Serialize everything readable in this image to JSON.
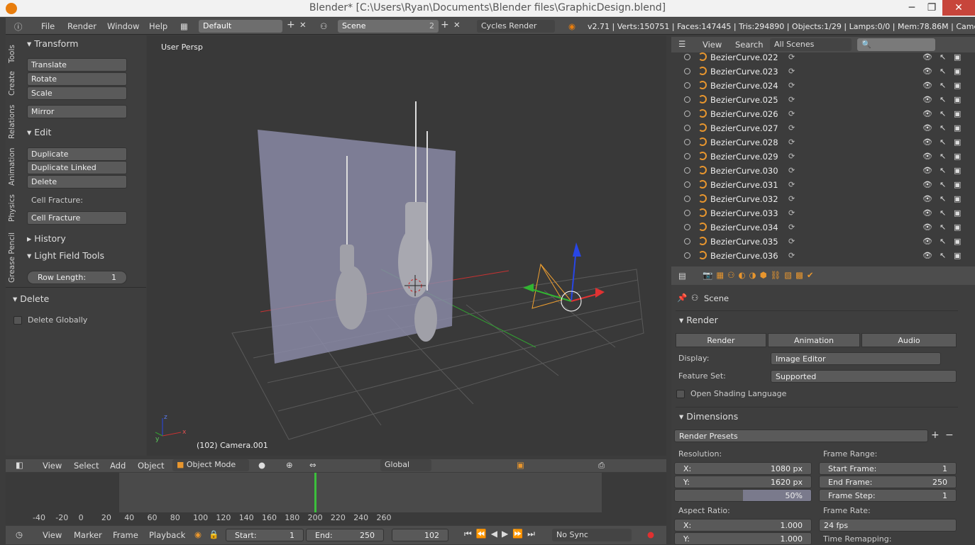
{
  "window": {
    "title": "Blender* [C:\\Users\\Ryan\\Documents\\Blender files\\GraphicDesign.blend]",
    "minimize": "─",
    "maximize": "❐",
    "close": "✕"
  },
  "infobar": {
    "menus": [
      "File",
      "Render",
      "Window",
      "Help"
    ],
    "screen_layout": "Default",
    "scene": "Scene",
    "scene_users": "2",
    "engine": "Cycles Render",
    "stats": "v2.71 | Verts:150751 | Faces:147445 | Tris:294890 | Objects:1/29 | Lamps:0/0 | Mem:78.86M | Camera.001"
  },
  "tool_tabs": [
    "Tools",
    "Create",
    "Relations",
    "Animation",
    "Physics",
    "Grease Pencil"
  ],
  "toolshelf": {
    "transform": {
      "title": "Transform",
      "buttons": [
        "Translate",
        "Rotate",
        "Scale",
        "Mirror"
      ]
    },
    "edit": {
      "title": "Edit",
      "buttons": [
        "Duplicate",
        "Duplicate Linked",
        "Delete"
      ],
      "cell_fracture_label": "Cell Fracture:",
      "cell_fracture_button": "Cell Fracture"
    },
    "history": {
      "title": "History"
    },
    "light_field": {
      "title": "Light Field Tools",
      "row_length_label": "Row Length:",
      "row_length_value": "1"
    }
  },
  "operator_panel": {
    "title": "Delete",
    "checkbox_label": "Delete Globally"
  },
  "viewport": {
    "view_name": "User Persp",
    "object_info": "(102) Camera.001"
  },
  "viewport_header": {
    "menus": [
      "View",
      "Select",
      "Add",
      "Object"
    ],
    "mode": "Object Mode",
    "orientation": "Global"
  },
  "timeline": {
    "ticks": [
      "-40",
      "-20",
      "0",
      "20",
      "40",
      "60",
      "80",
      "100",
      "120",
      "140",
      "160",
      "180",
      "200",
      "220",
      "240",
      "260"
    ],
    "current_frame": 102,
    "footer_menus": [
      "View",
      "Marker",
      "Frame",
      "Playback"
    ],
    "start_label": "Start:",
    "start": "1",
    "end_label": "End:",
    "end": "250",
    "frame": "102",
    "sync": "No Sync"
  },
  "outliner": {
    "menus": [
      "View",
      "Search"
    ],
    "filter": "All Scenes",
    "items": [
      "BezierCurve.022",
      "BezierCurve.023",
      "BezierCurve.024",
      "BezierCurve.025",
      "BezierCurve.026",
      "BezierCurve.027",
      "BezierCurve.028",
      "BezierCurve.029",
      "BezierCurve.030",
      "BezierCurve.031",
      "BezierCurve.032",
      "BezierCurve.033",
      "BezierCurve.034",
      "BezierCurve.035",
      "BezierCurve.036"
    ]
  },
  "properties": {
    "context": "Scene",
    "render_section": "Render",
    "render_buttons": [
      "Render",
      "Animation",
      "Audio"
    ],
    "display_label": "Display:",
    "display_value": "Image Editor",
    "feature_label": "Feature Set:",
    "feature_value": "Supported",
    "osl_label": "Open Shading Language",
    "dimensions_section": "Dimensions",
    "render_presets": "Render Presets",
    "resolution_label": "Resolution:",
    "res_x_label": "X:",
    "res_x": "1080 px",
    "res_y_label": "Y:",
    "res_y": "1620 px",
    "res_percent": "50%",
    "frame_range_label": "Frame Range:",
    "start_frame_label": "Start Frame:",
    "start_frame": "1",
    "end_frame_label": "End Frame:",
    "end_frame": "250",
    "frame_step_label": "Frame Step:",
    "frame_step": "1",
    "aspect_label": "Aspect Ratio:",
    "aspect_x_label": "X:",
    "aspect_x": "1.000",
    "aspect_y_label": "Y:",
    "aspect_y": "1.000",
    "frame_rate_label": "Frame Rate:",
    "frame_rate": "24 fps",
    "time_remap_label": "Time Remapping:"
  },
  "colors": {
    "accent": "#e87d0d",
    "selection": "#f0a030",
    "playhead": "#3cbf3c",
    "x_axis": "#c83232",
    "y_axis": "#32a032",
    "z_axis": "#2846e6"
  }
}
